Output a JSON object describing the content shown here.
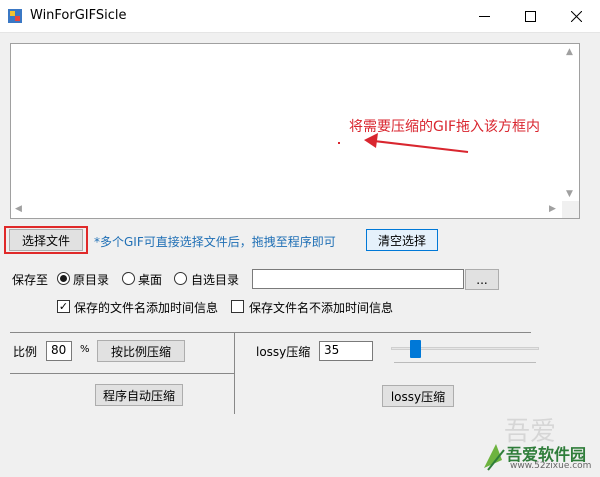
{
  "window": {
    "title": "WinForGIFSicle"
  },
  "drop_area": {
    "hint": "将需要压缩的GIF拖入该方框内"
  },
  "toolbar": {
    "select_file": "选择文件",
    "hint": "*多个GIF可直接选择文件后，拖拽至程序即可",
    "clear_selection": "清空选择"
  },
  "save": {
    "label": "保存至",
    "options": [
      "原目录",
      "桌面",
      "自选目录"
    ],
    "selected": "原目录",
    "path_value": "",
    "browse": "...",
    "add_time_label": "保存的文件名添加时间信息",
    "add_time_checked": true,
    "no_time_label": "保存文件名不添加时间信息",
    "no_time_checked": false
  },
  "ratio": {
    "label": "比例",
    "value": "80",
    "unit": "%",
    "compress_button": "按比例压缩",
    "auto_button": "程序自动压缩"
  },
  "lossy": {
    "label": "lossy压缩",
    "value": "35",
    "slider_fraction": 0.14,
    "compress_button": "lossy压缩"
  },
  "watermark": {
    "name": "吾爱软件园",
    "url": "www.52zixue.com"
  }
}
